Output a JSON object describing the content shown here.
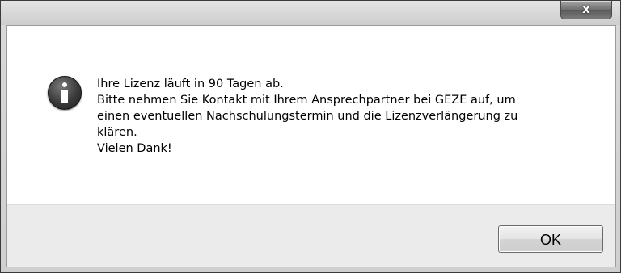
{
  "dialog": {
    "close_symbol": "x",
    "icon": "info-icon",
    "message_lines": [
      "Ihre Lizenz läuft in 90 Tagen ab.",
      "Bitte nehmen Sie Kontakt mit Ihrem Ansprechpartner bei GEZE auf, um",
      "einen eventuellen Nachschulungstermin und die Lizenzverlängerung zu",
      "klären.",
      "Vielen Dank!"
    ],
    "ok_label": "OK"
  }
}
